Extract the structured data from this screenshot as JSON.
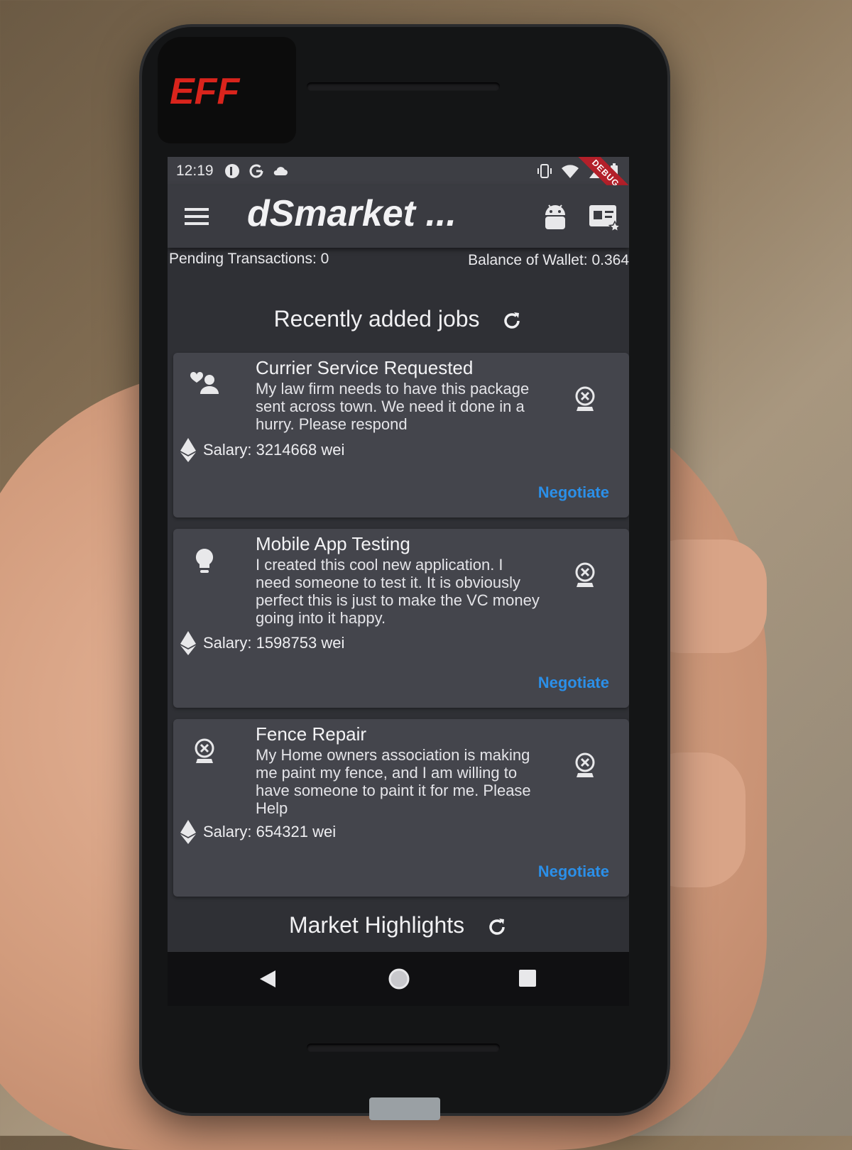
{
  "status_bar": {
    "time": "12:19",
    "debug_banner": "DEBUG"
  },
  "phone": {
    "sticker_text": "EFF"
  },
  "app_bar": {
    "title": "dSmarket ..."
  },
  "info": {
    "pending_transactions": "Pending Transactions: 0",
    "wallet_balance": "Balance of Wallet: 0.364"
  },
  "recent_jobs": {
    "title": "Recently added jobs",
    "jobs": [
      {
        "title": "Currier Service Requested",
        "description": "My law firm needs to have this package sent across town. We need it done in a hurry. Please respond",
        "salary": "Salary: 3214668 wei",
        "action": "Negotiate",
        "icon": "volunteer-activism-icon"
      },
      {
        "title": "Mobile App Testing",
        "description": "I created this cool new application. I need someone to test it. It is obviously perfect this is just to make the VC money going into it happy.",
        "salary": "Salary: 1598753 wei",
        "action": "Negotiate",
        "icon": "lightbulb-icon"
      },
      {
        "title": "Fence Repair",
        "description": "My Home owners association is making me paint my fence, and I am willing to have someone to paint it for me. Please Help",
        "salary": "Salary: 654321 wei",
        "action": "Negotiate",
        "icon": "webcam-off-icon"
      }
    ]
  },
  "market_highlights": {
    "title": "Market Highlights"
  },
  "colors": {
    "accent": "#2b8fe8",
    "debug": "#b3202a",
    "sticker": "#d9241c"
  }
}
